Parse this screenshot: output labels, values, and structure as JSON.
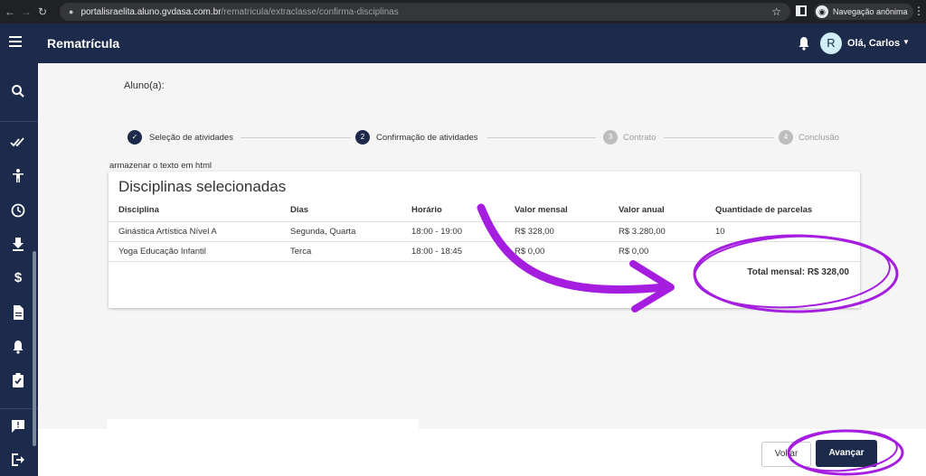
{
  "browser": {
    "url_host": "portalisraelita.aluno.gvdasa.com.br",
    "url_path": "/rematricula/extraclasse/confirma-disciplinas",
    "profile_label": "Navegação anônima"
  },
  "header": {
    "title": "Rematrícula",
    "avatar_initial": "R",
    "greeting": "Olá, Carlos"
  },
  "page": {
    "student_label": "Aluno(a):",
    "note": "armazenar o texto em html"
  },
  "stepper": [
    {
      "label": "Seleção de atividades",
      "marker": "✓",
      "state": "done"
    },
    {
      "label": "Confirmação de atividades",
      "marker": "2",
      "state": "active"
    },
    {
      "label": "Contrato",
      "marker": "3",
      "state": "inactive"
    },
    {
      "label": "Conclusão",
      "marker": "4",
      "state": "inactive"
    }
  ],
  "card": {
    "title": "Disciplinas selecionadas",
    "columns": [
      "Disciplina",
      "Dias",
      "Horário",
      "Valor mensal",
      "Valor anual",
      "Quantidade de parcelas"
    ],
    "rows": [
      [
        "Ginástica Artística Nível A",
        "Segunda, Quarta",
        "18:00 - 19:00",
        "R$ 328,00",
        "R$ 3.280,00",
        "10"
      ],
      [
        "Yoga Educação Infantil",
        "Terca",
        "18:00 - 18:45",
        "R$ 0,00",
        "R$ 0,00",
        ""
      ]
    ],
    "total": "Total mensal: R$ 328,00"
  },
  "actions": {
    "back_label": "Voltar",
    "next_label": "Avançar"
  },
  "colors": {
    "brand": "#1c2b4b",
    "annotation": "#a51ee0"
  },
  "icons": {
    "sidebar": [
      "search-icon",
      "double-check-icon",
      "accessibility-icon",
      "clock-icon",
      "download-icon",
      "dollar-icon",
      "document-icon",
      "bell-icon",
      "clipboard-check-icon",
      "chat-icon",
      "logout-icon"
    ]
  }
}
